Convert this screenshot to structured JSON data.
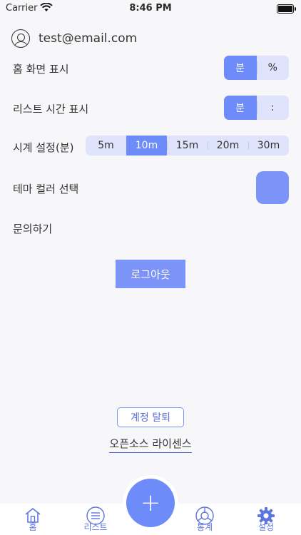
{
  "status_bar": {
    "carrier": "Carrier",
    "time": "8:46 PM"
  },
  "account": {
    "email": "test@email.com"
  },
  "settings": {
    "home_display": {
      "label": "홈 화면 표시",
      "options": [
        "분",
        "%"
      ],
      "selected": "분"
    },
    "list_time_display": {
      "label": "리스트 시간 표시",
      "options": [
        "분",
        ":"
      ],
      "selected": "분"
    },
    "clock_setting": {
      "label": "시계 설정(분)",
      "options": [
        "5m",
        "10m",
        "15m",
        "20m",
        "30m"
      ],
      "selected": "10m"
    },
    "theme_color": {
      "label": "테마 컬러 선택",
      "color": "#7c93f8"
    },
    "contact": {
      "label": "문의하기"
    }
  },
  "logout_label": "로그아웃",
  "withdraw_label": "계정 탈퇴",
  "license_label": "오픈소스 라이센스",
  "tabbar": {
    "fab_label": "+",
    "tabs": [
      {
        "label": "홈",
        "icon": "home-icon"
      },
      {
        "label": "리스트",
        "icon": "list-icon"
      },
      {
        "label": "통계",
        "icon": "pie-chart-icon"
      },
      {
        "label": "설정",
        "icon": "gear-icon"
      }
    ]
  },
  "colors": {
    "accent": "#6e8bfa",
    "segment_bg": "#dfe3fb",
    "page_bg": "#f7f7fa"
  }
}
